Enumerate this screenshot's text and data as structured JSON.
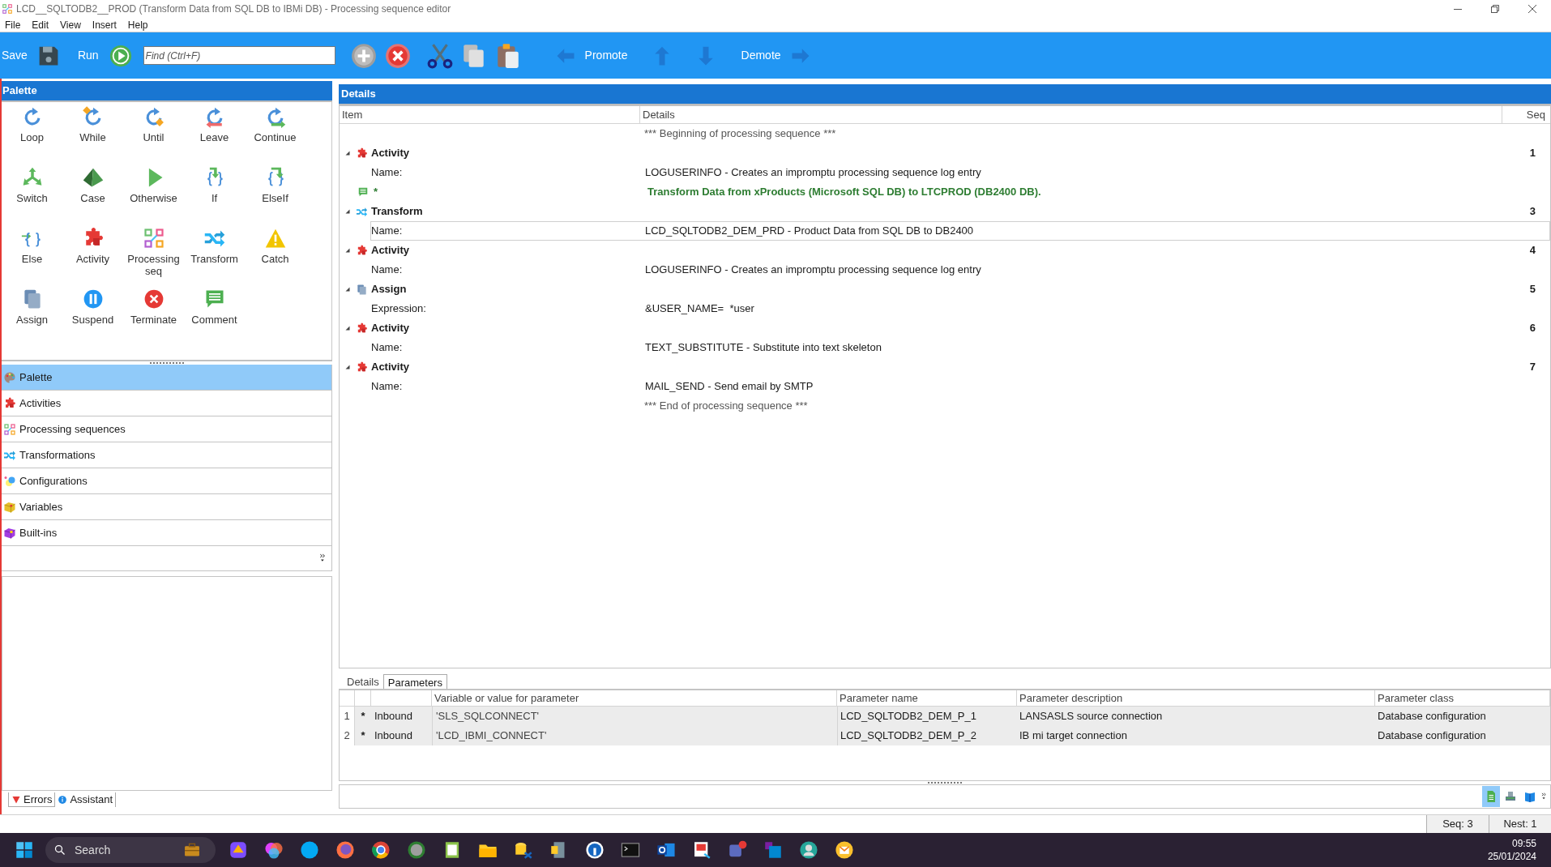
{
  "window": {
    "title": "LCD__SQLTODB2__PROD (Transform Data from SQL DB to IBMi DB) - Processing sequence editor"
  },
  "menu": [
    {
      "label": "File"
    },
    {
      "label": "Edit"
    },
    {
      "label": "View"
    },
    {
      "label": "Insert"
    },
    {
      "label": "Help"
    }
  ],
  "toolbar": {
    "save": "Save",
    "run": "Run",
    "find_placeholder": "Find (Ctrl+F)",
    "promote": "Promote",
    "demote": "Demote"
  },
  "palette": {
    "title": "Palette",
    "items": [
      {
        "label": "Loop",
        "kind": "loop"
      },
      {
        "label": "While",
        "kind": "while"
      },
      {
        "label": "Until",
        "kind": "until"
      },
      {
        "label": "Leave",
        "kind": "leave"
      },
      {
        "label": "Continue",
        "kind": "continue"
      },
      {
        "label": "Switch",
        "kind": "switch"
      },
      {
        "label": "Case",
        "kind": "case"
      },
      {
        "label": "Otherwise",
        "kind": "otherwise"
      },
      {
        "label": "If",
        "kind": "if"
      },
      {
        "label": "ElseIf",
        "kind": "elseif"
      },
      {
        "label": "Else",
        "kind": "else"
      },
      {
        "label": "Activity",
        "kind": "activity"
      },
      {
        "label": "Processing seq",
        "kind": "procseq"
      },
      {
        "label": "Transform",
        "kind": "transform"
      },
      {
        "label": "Catch",
        "kind": "catch"
      },
      {
        "label": "Assign",
        "kind": "assign"
      },
      {
        "label": "Suspend",
        "kind": "suspend"
      },
      {
        "label": "Terminate",
        "kind": "terminate"
      },
      {
        "label": "Comment",
        "kind": "comment"
      }
    ]
  },
  "navigator": [
    {
      "label": "Palette",
      "kind": "palette",
      "selected": true
    },
    {
      "label": "Activities",
      "kind": "activity",
      "selected": false
    },
    {
      "label": "Processing sequences",
      "kind": "procseq",
      "selected": false
    },
    {
      "label": "Transformations",
      "kind": "transform",
      "selected": false
    },
    {
      "label": "Configurations",
      "kind": "config",
      "selected": false
    },
    {
      "label": "Variables",
      "kind": "variables",
      "selected": false
    },
    {
      "label": "Built-ins",
      "kind": "builtins",
      "selected": false
    }
  ],
  "bottom_left_tabs": [
    {
      "label": "Errors",
      "kind": "error",
      "selected": true
    },
    {
      "label": "Assistant",
      "kind": "info",
      "selected": false
    }
  ],
  "details": {
    "title": "Details",
    "columns": [
      "Item",
      "Details",
      "Seq"
    ],
    "rows": [
      {
        "kind": "marker",
        "text": "*** Beginning of processing sequence ***"
      },
      {
        "kind": "activity",
        "label": "Activity",
        "seq": "1",
        "expanded": true,
        "children": [
          {
            "label": "Name:",
            "value": "LOGUSERINFO - Creates an impromptu processing sequence log entry",
            "selected": false
          }
        ]
      },
      {
        "kind": "comment",
        "label": "*",
        "text": "Transform Data from xProducts (Microsoft SQL DB) to LTCPROD (DB2400 DB)."
      },
      {
        "kind": "transform",
        "label": "Transform",
        "seq": "3",
        "expanded": true,
        "children": [
          {
            "label": "Name:",
            "value": "LCD_SQLTODB2_DEM_PRD - Product Data from SQL DB to DB2400",
            "selected": true
          }
        ]
      },
      {
        "kind": "activity",
        "label": "Activity",
        "seq": "4",
        "expanded": true,
        "children": [
          {
            "label": "Name:",
            "value": "LOGUSERINFO - Creates an impromptu processing sequence log entry",
            "selected": false
          }
        ]
      },
      {
        "kind": "assign",
        "label": "Assign",
        "seq": "5",
        "expanded": true,
        "children": [
          {
            "label": "Expression:",
            "value": "&USER_NAME=  *user",
            "selected": false
          }
        ]
      },
      {
        "kind": "activity",
        "label": "Activity",
        "seq": "6",
        "expanded": true,
        "children": [
          {
            "label": "Name:",
            "value": "TEXT_SUBSTITUTE - Substitute into text skeleton",
            "selected": false
          }
        ]
      },
      {
        "kind": "activity",
        "label": "Activity",
        "seq": "7",
        "expanded": true,
        "children": [
          {
            "label": "Name:",
            "value": "MAIL_SEND - Send email by SMTP",
            "selected": false
          }
        ]
      },
      {
        "kind": "marker",
        "text": "*** End of processing sequence ***"
      }
    ]
  },
  "lower_tabs": [
    {
      "label": "Details",
      "selected": false
    },
    {
      "label": "Parameters",
      "selected": true
    }
  ],
  "parameters": {
    "columns": [
      "Variable or value for parameter",
      "Parameter name",
      "Parameter description",
      "Parameter class"
    ],
    "rows": [
      {
        "number": "1",
        "marker": "*",
        "direction": "Inbound",
        "value": "'SLS_SQLCONNECT'",
        "name": "LCD_SQLTODB2_DEM_P_1",
        "description": "LANSASLS source connection",
        "class": "Database configuration"
      },
      {
        "number": "2",
        "marker": "*",
        "direction": "Inbound",
        "value": "'LCD_IBMI_CONNECT'",
        "name": "LCD_SQLTODB2_DEM_P_2",
        "description": "IB mi target connection",
        "class": "Database configuration"
      }
    ]
  },
  "view_buttons": [
    {
      "selected": true
    },
    {
      "selected": false
    },
    {
      "selected": false
    }
  ],
  "status_bar": {
    "seq": "Seq: 3",
    "nest": "Nest: 1"
  },
  "taskbar": {
    "search_placeholder": "Search",
    "time": "09:55",
    "date": "25/01/2024"
  }
}
